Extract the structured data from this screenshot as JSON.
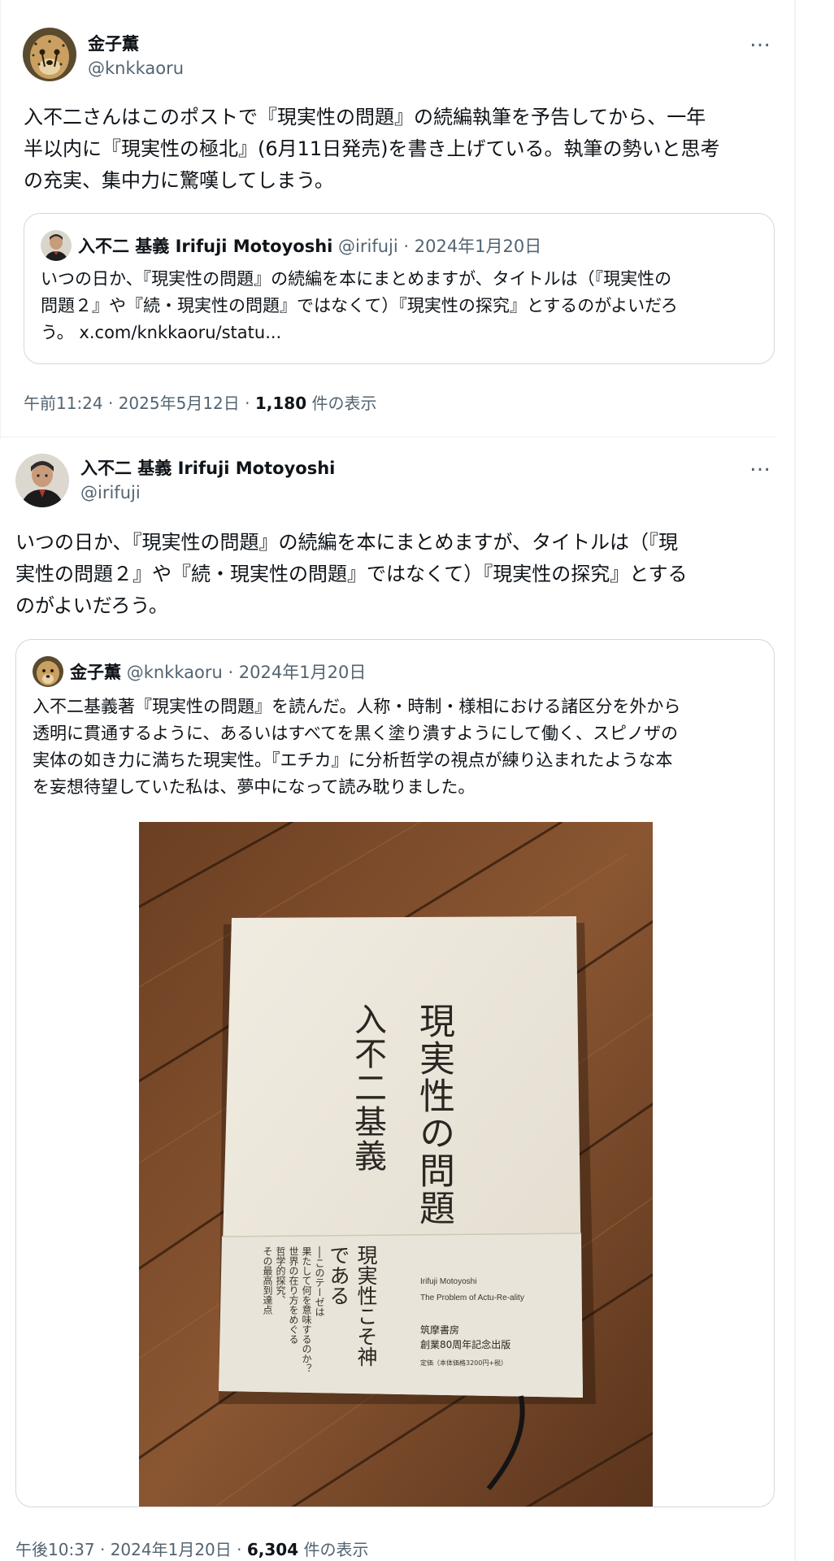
{
  "tweets": [
    {
      "author_name": "金子薫",
      "author_handle": "@knkkaoru",
      "text_lines": [
        "入不二さんはこのポストで『現実性の問題』の続編執筆を予告してから、一年",
        "半以内に『現実性の極北』(6月11日発売)を書き上げている。執筆の勢いと思考",
        "の充実、集中力に驚嘆してしまう。"
      ],
      "quote": {
        "author_name": "入不二 基義 Irifuji Motoyoshi",
        "meta": "@irifuji · 2024年1月20日",
        "text_lines": [
          "いつの日か、『現実性の問題』の続編を本にまとめますが、タイトルは（『現実性の",
          "問題２』や『続・現実性の問題』ではなくて）『現実性の探究』とするのがよいだろ",
          "う。 x.com/knkkaoru/statu..."
        ]
      },
      "meta": {
        "time_date": "午前11:24 · 2025年5月12日 · ",
        "views_count": "1,180",
        "views_label": " 件の表示"
      }
    },
    {
      "author_name": "入不二 基義 Irifuji Motoyoshi",
      "author_handle": "@irifuji",
      "text_lines": [
        "いつの日か、『現実性の問題』の続編を本にまとめますが、タイトルは（『現",
        "実性の問題２』や『続・現実性の問題』ではなくて）『現実性の探究』とする",
        "のがよいだろう。"
      ],
      "quote": {
        "author_name": "金子薫",
        "meta": "@knkkaoru · 2024年1月20日",
        "text_lines": [
          "入不二基義著『現実性の問題』を読んだ。人称・時制・様相における諸区分を外から",
          "透明に貫通するように、あるいはすべてを黒く塗り潰すようにして働く、スピノザの",
          "実体の如き力に満ちた現実性。『エチカ』に分析哲学の視点が練り込まれたような本",
          "を妄想待望していた私は、夢中になって読み耽りました。"
        ],
        "book": {
          "title": "現実性の問題",
          "author": "入不二基義",
          "band_title": "現実性こそ神である",
          "band_sub": [
            "──このテーゼは",
            "果たして何を意味するのか？",
            "世界の在り方をめぐる",
            "哲学的探究、",
            "その最高到達点"
          ],
          "roman_author": "Irifuji Motoyoshi",
          "roman_title": "The Problem of Actu-Re-ality",
          "publisher": "筑摩書房",
          "anniversary": "創業80周年記念出版",
          "price": "定価（本体価格3200円+税）"
        }
      },
      "meta": {
        "time_date": "午後10:37 · 2024年1月20日 · ",
        "views_count": "6,304",
        "views_label": " 件の表示"
      }
    }
  ],
  "more_icon": "…"
}
